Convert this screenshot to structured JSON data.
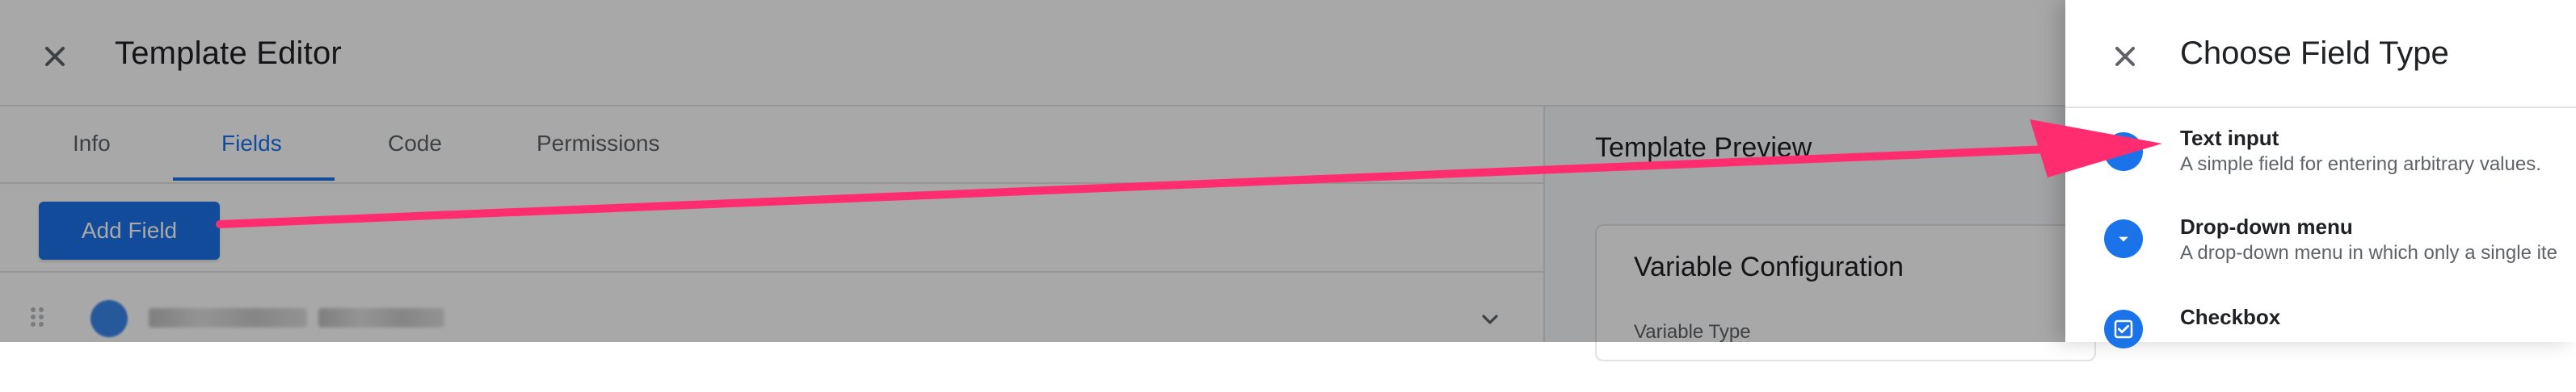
{
  "main": {
    "title": "Template Editor",
    "tabs": [
      {
        "label": "Info"
      },
      {
        "label": "Fields"
      },
      {
        "label": "Code"
      },
      {
        "label": "Permissions"
      }
    ],
    "add_field_label": "Add Field",
    "preview": {
      "title": "Template Preview",
      "card_title": "Variable Configuration",
      "variable_type_label": "Variable Type"
    }
  },
  "panel": {
    "title": "Choose Field Type",
    "options": [
      {
        "title": "Text input",
        "desc": "A simple field for entering arbitrary values."
      },
      {
        "title": "Drop-down menu",
        "desc": "A drop-down menu in which only a single ite"
      },
      {
        "title": "Checkbox",
        "desc": ""
      }
    ]
  },
  "colors": {
    "accent": "#1a73e8",
    "arrow": "#ff2d6f"
  },
  "icons": {
    "close": "close-icon",
    "chevron": "chevron-down-icon",
    "drag": "drag-handle-icon",
    "dropdown": "dropdown-icon",
    "checkbox": "checkbox-icon"
  }
}
